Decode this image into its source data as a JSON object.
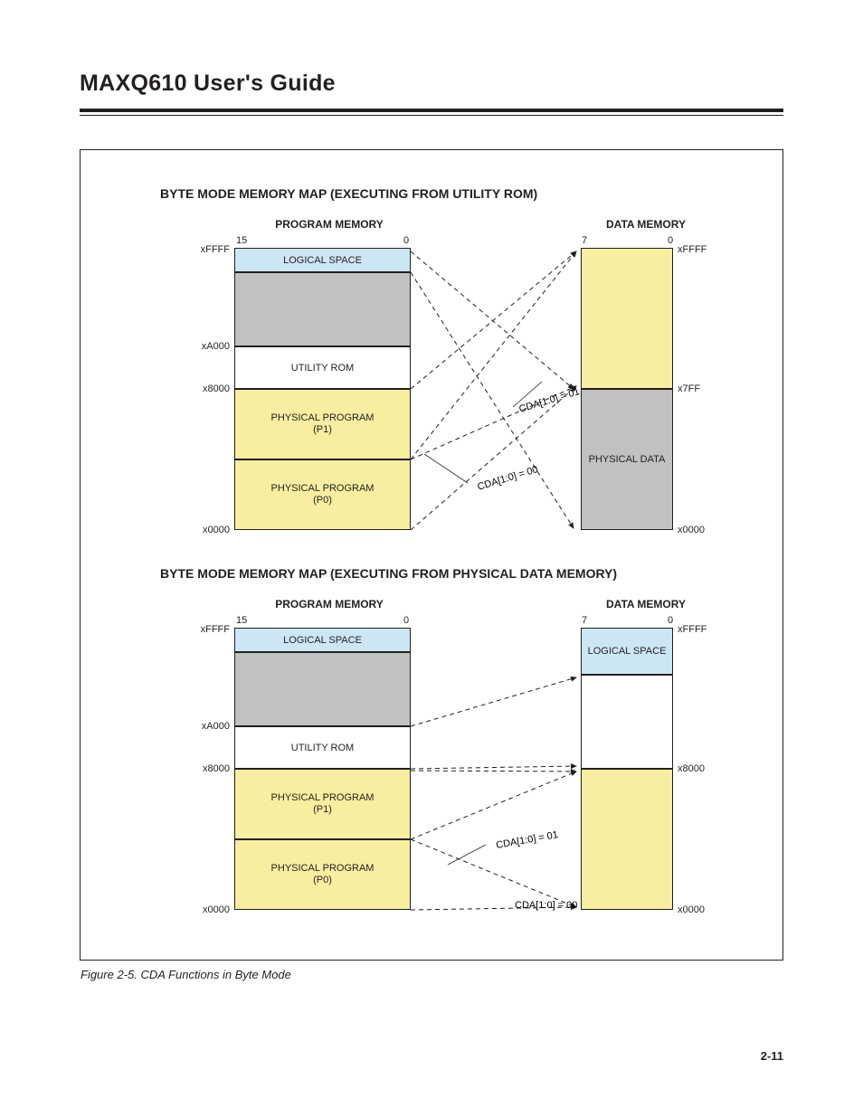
{
  "page_title": "MAXQ610 User's Guide",
  "caption": "Figure 2-5. CDA Functions in Byte Mode",
  "page_number": "2-11",
  "map1": {
    "title": "BYTE MODE MEMORY MAP (EXECUTING FROM UTILITY ROM)",
    "prog_title": "PROGRAM MEMORY",
    "data_title": "DATA MEMORY",
    "bit15": "15",
    "bit0": "0",
    "bit7": "7",
    "addr": {
      "xFFFF_L": "xFFFF",
      "xA000": "xA000",
      "x8000": "x8000",
      "x0000": "x0000",
      "xFFFF_R": "xFFFF",
      "x7FF": "x7FF",
      "x0000_R": "x0000"
    },
    "blocks": {
      "logical": "LOGICAL SPACE",
      "utility": "UTILITY ROM",
      "p1a": "PHYSICAL PROGRAM",
      "p1b": "(P1)",
      "p0a": "PHYSICAL PROGRAM",
      "p0b": "(P0)",
      "pdata": "PHYSICAL DATA"
    },
    "cda0": "CDA[1:0] = 00",
    "cda1": "CDA[1:0] = 01"
  },
  "map2": {
    "title": "BYTE MODE MEMORY MAP (EXECUTING FROM PHYSICAL DATA MEMORY)",
    "prog_title": "PROGRAM MEMORY",
    "data_title": "DATA MEMORY",
    "bit15": "15",
    "bit0": "0",
    "bit7": "7",
    "addr": {
      "xFFFF_L": "xFFFF",
      "xA000": "xA000",
      "x8000": "x8000",
      "x0000": "x0000",
      "xFFFF_R": "xFFFF",
      "x8000_R": "x8000",
      "x0000_R": "x0000"
    },
    "blocks": {
      "logical": "LOGICAL SPACE",
      "utility": "UTILITY ROM",
      "p1a": "PHYSICAL PROGRAM",
      "p1b": "(P1)",
      "p0a": "PHYSICAL PROGRAM",
      "p0b": "(P0)",
      "logicalR": "LOGICAL SPACE"
    },
    "cda0": "CDA[1:0] = 00",
    "cda1": "CDA[1:0] = 01"
  }
}
